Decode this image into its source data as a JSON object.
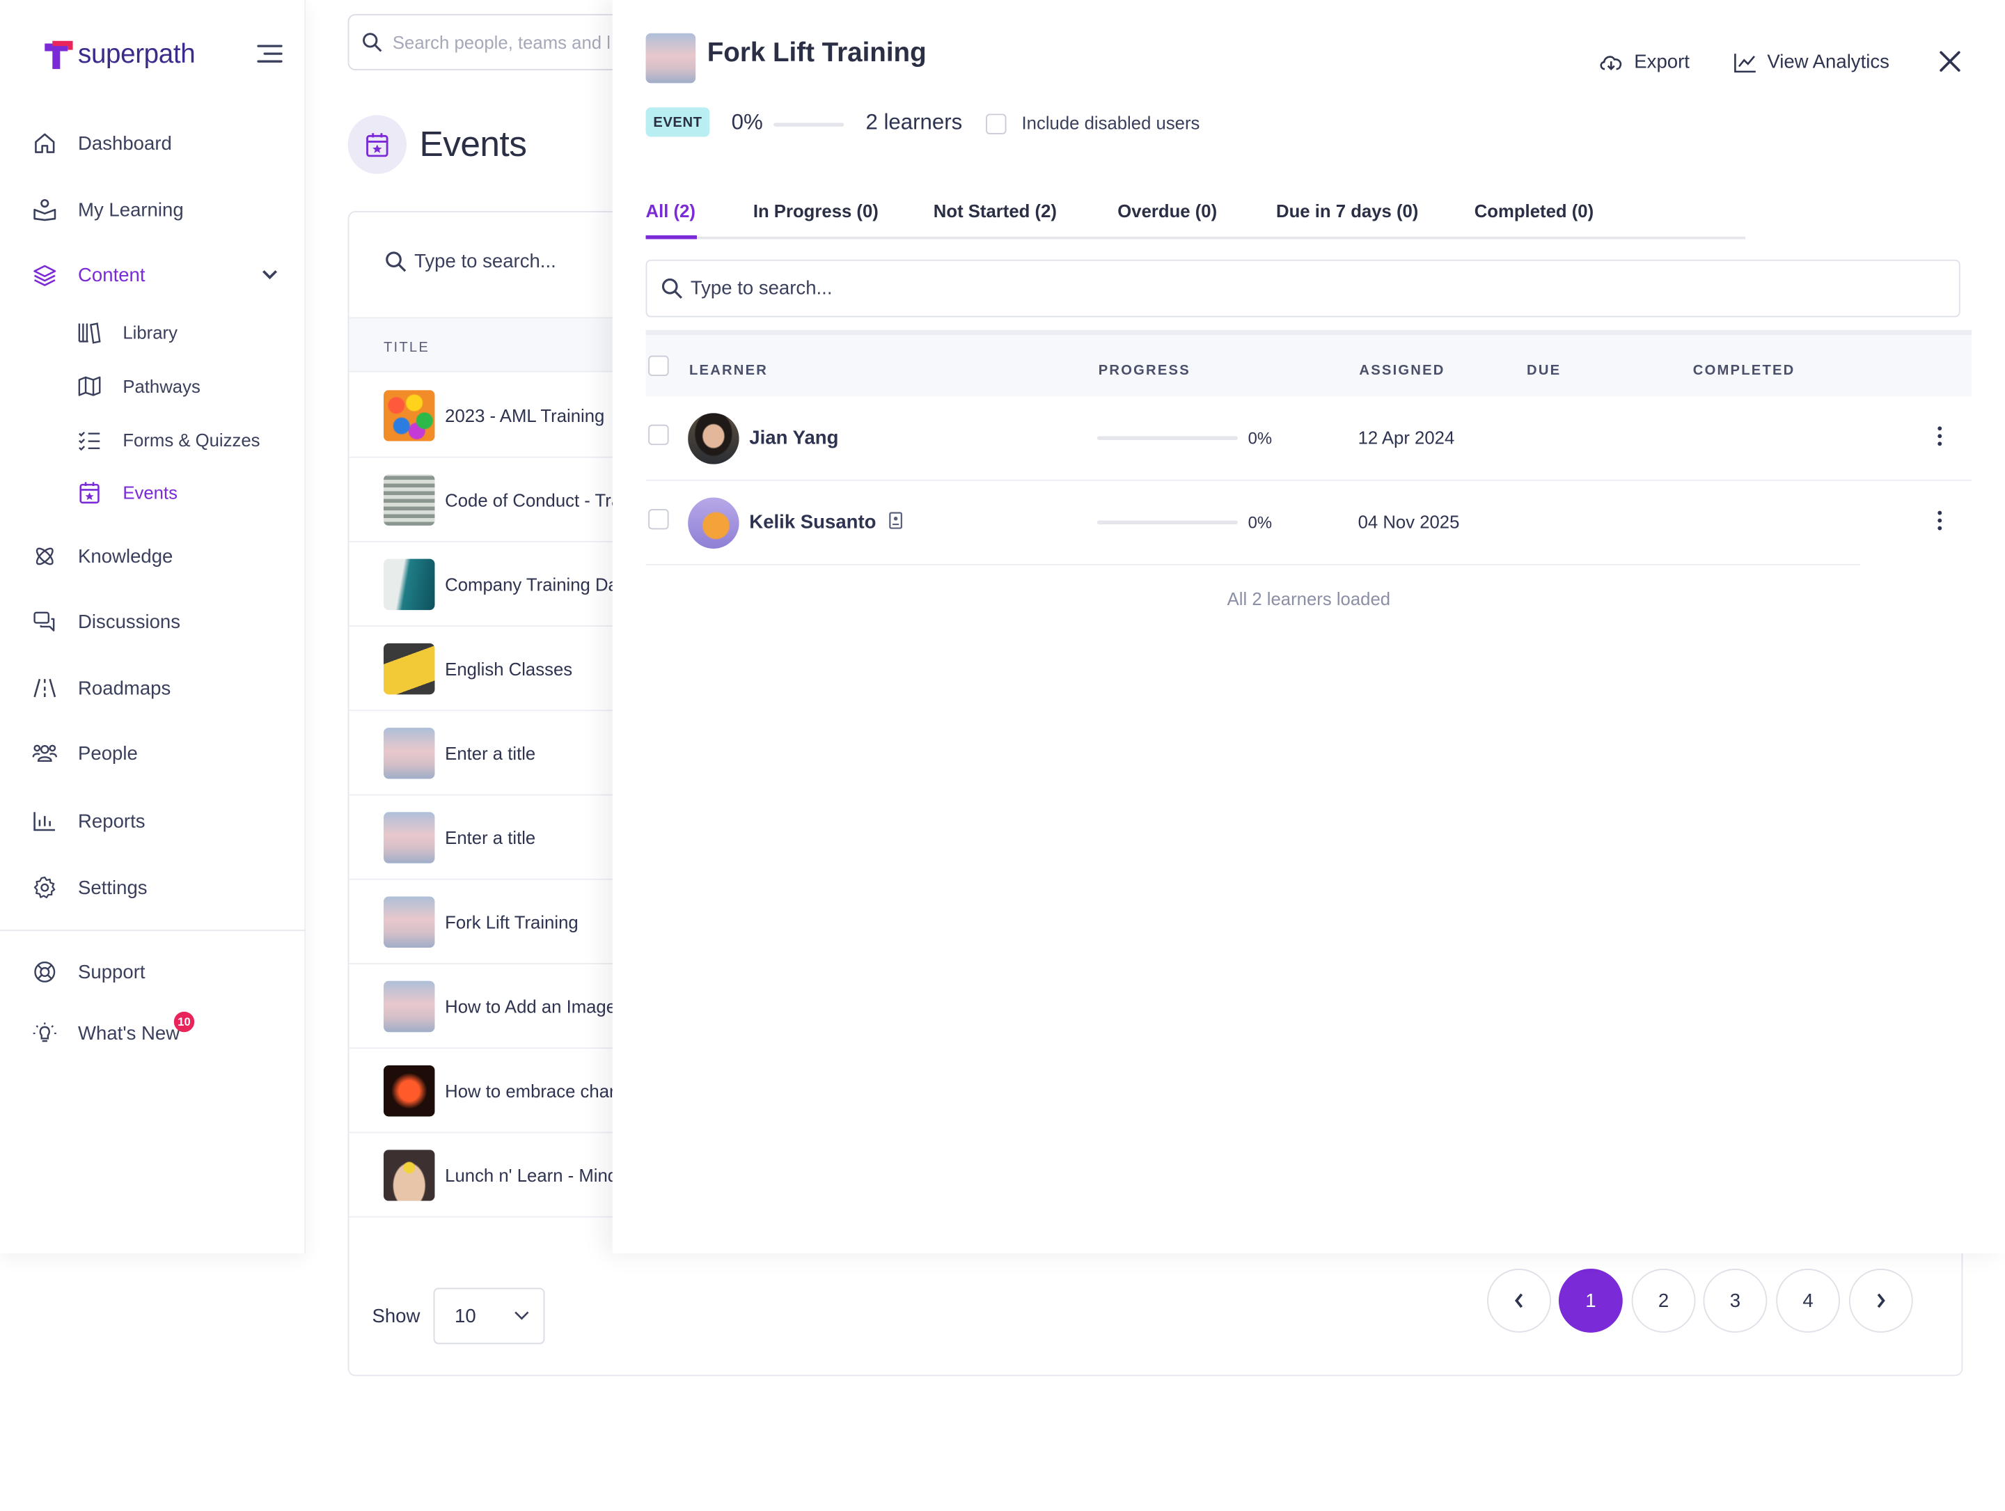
{
  "brand": {
    "name": "superpath"
  },
  "sidebar": {
    "items": [
      {
        "label": "Dashboard"
      },
      {
        "label": "My Learning"
      },
      {
        "label": "Content"
      },
      {
        "label": "Knowledge"
      },
      {
        "label": "Discussions"
      },
      {
        "label": "Roadmaps"
      },
      {
        "label": "People"
      },
      {
        "label": "Reports"
      },
      {
        "label": "Settings"
      }
    ],
    "content_sub": [
      {
        "label": "Library"
      },
      {
        "label": "Pathways"
      },
      {
        "label": "Forms & Quizzes"
      },
      {
        "label": "Events"
      }
    ],
    "footer": [
      {
        "label": "Support"
      },
      {
        "label": "What's New"
      }
    ],
    "whats_new_count": "10"
  },
  "global_search": {
    "placeholder": "Search people, teams and l"
  },
  "events_page": {
    "title": "Events",
    "search_placeholder": "Type to search...",
    "column_title": "TITLE",
    "rows": [
      {
        "title": "2023 - AML Training"
      },
      {
        "title": "Code of Conduct - Tra"
      },
      {
        "title": "Company Training Da"
      },
      {
        "title": "English Classes"
      },
      {
        "title": "Enter a title"
      },
      {
        "title": "Enter a title"
      },
      {
        "title": "Fork Lift Training"
      },
      {
        "title": "How to Add an Image"
      },
      {
        "title": "How to embrace char"
      },
      {
        "title": "Lunch n' Learn - Mind"
      }
    ],
    "show_label": "Show",
    "page_size": "10",
    "pages": [
      "1",
      "2",
      "3",
      "4"
    ],
    "current_page": "1"
  },
  "panel": {
    "title": "Fork Lift Training",
    "export_label": "Export",
    "analytics_label": "View Analytics",
    "badge": "EVENT",
    "progress": "0%",
    "learners": "2 learners",
    "include_disabled": "Include disabled users",
    "tabs": [
      {
        "label": "All (2)"
      },
      {
        "label": "In Progress (0)"
      },
      {
        "label": "Not Started (2)"
      },
      {
        "label": "Overdue (0)"
      },
      {
        "label": "Due in 7 days (0)"
      },
      {
        "label": "Completed (0)"
      }
    ],
    "search_placeholder": "Type to search...",
    "columns": {
      "learner": "LEARNER",
      "progress": "PROGRESS",
      "assigned": "ASSIGNED",
      "due": "DUE",
      "completed": "COMPLETED"
    },
    "learners_list": [
      {
        "name": "Jian Yang",
        "progress": "0%",
        "assigned": "12 Apr 2024",
        "due": "",
        "completed": ""
      },
      {
        "name": "Kelik Susanto",
        "progress": "0%",
        "assigned": "04 Nov 2025",
        "due": "",
        "completed": ""
      }
    ],
    "loaded_text": "All 2 learners loaded"
  },
  "colors": {
    "accent": "#7a2ad6",
    "badge_bg": "#b9eef2",
    "notif": "#e8245a"
  }
}
